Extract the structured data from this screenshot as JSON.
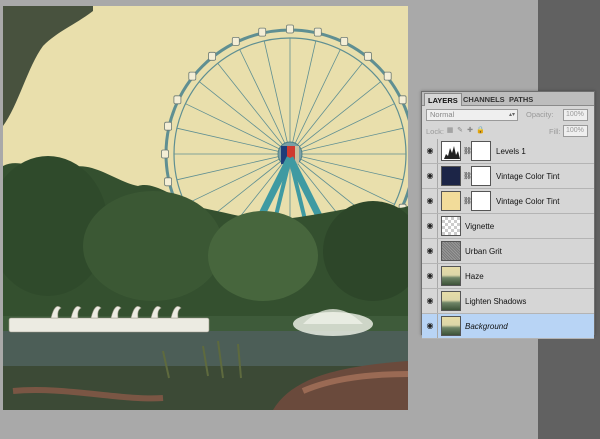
{
  "panel": {
    "tabs": [
      {
        "label": "LAYERS",
        "active": true
      },
      {
        "label": "CHANNELS",
        "active": false
      },
      {
        "label": "PATHS",
        "active": false
      }
    ],
    "blend_mode": "Normal",
    "opacity_label": "Opacity:",
    "opacity_value": "100%",
    "lock_label": "Lock:",
    "fill_label": "Fill:",
    "fill_value": "100%",
    "layers": [
      {
        "name": "Levels 1",
        "thumb": "levels-icon",
        "mask": true,
        "selected": false
      },
      {
        "name": "Vintage Color Tint",
        "thumb": "navy",
        "mask": true,
        "selected": false
      },
      {
        "name": "Vintage  Color Tint",
        "thumb": "cream",
        "mask": true,
        "selected": false
      },
      {
        "name": "Vignette",
        "thumb": "checker",
        "mask": false,
        "selected": false
      },
      {
        "name": "Urban Grit",
        "thumb": "grit",
        "mask": false,
        "selected": false
      },
      {
        "name": "Haze",
        "thumb": "photo",
        "mask": false,
        "selected": false
      },
      {
        "name": "Lighten Shadows",
        "thumb": "photo",
        "mask": false,
        "selected": false
      },
      {
        "name": "Background",
        "thumb": "photo",
        "mask": false,
        "selected": true
      }
    ]
  },
  "colors": {
    "selected_row": "#b8d4f5",
    "panel_bg": "#d6d6d6",
    "workspace": "#a9a9a9"
  }
}
